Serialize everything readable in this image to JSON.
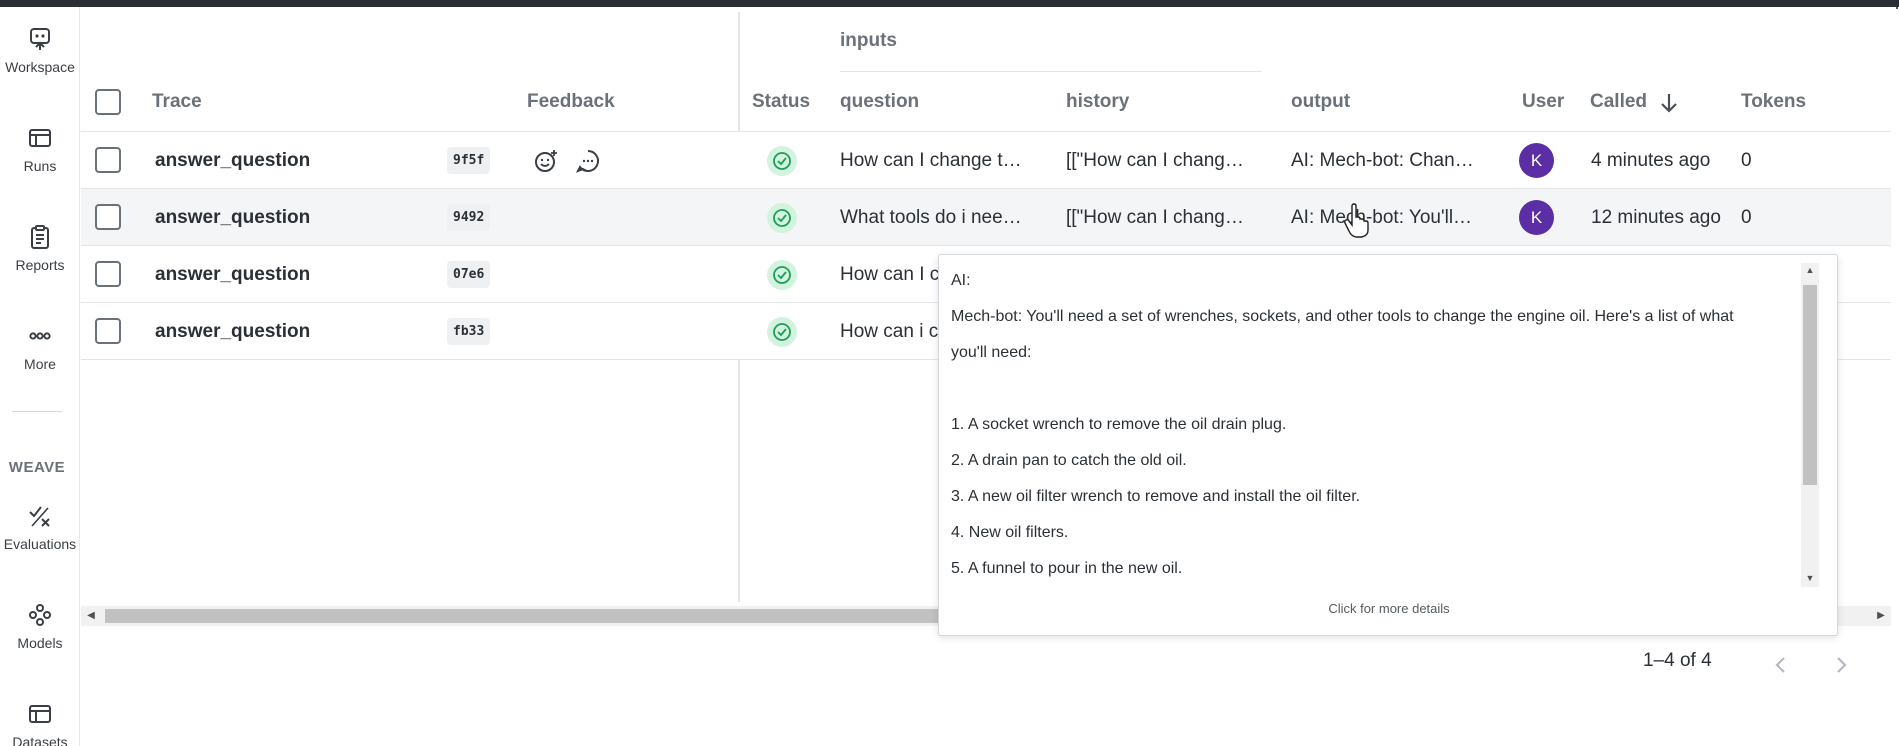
{
  "sidebar": {
    "items": [
      {
        "label": "Workspace",
        "icon": "workspace-icon"
      },
      {
        "label": "Runs",
        "icon": "runs-icon"
      },
      {
        "label": "Reports",
        "icon": "reports-icon"
      },
      {
        "label": "More",
        "icon": "more-icon"
      },
      {
        "label": "Evaluations",
        "icon": "evaluations-icon"
      },
      {
        "label": "Models",
        "icon": "models-icon"
      },
      {
        "label": "Datasets",
        "icon": "datasets-icon"
      }
    ],
    "section_label": "WEAVE"
  },
  "table": {
    "group_header": "inputs",
    "columns": {
      "trace": "Trace",
      "feedback": "Feedback",
      "status": "Status",
      "question": "question",
      "history": "history",
      "output": "output",
      "user": "User",
      "called": "Called",
      "tokens": "Tokens"
    },
    "rows": [
      {
        "name": "answer_question",
        "id": "9f5f",
        "question": "How can I change t…",
        "history": "[[\"How can I chang…",
        "output": "AI: Mech-bot: Chan…",
        "user": "K",
        "called": "4 minutes ago",
        "tokens": "0"
      },
      {
        "name": "answer_question",
        "id": "9492",
        "question": "What tools do i nee…",
        "history": "[[\"How can I chang…",
        "output": "AI: Mech-bot: You'll…",
        "user": "K",
        "called": "12 minutes ago",
        "tokens": "0"
      },
      {
        "name": "answer_question",
        "id": "07e6",
        "question": "How can I c",
        "history": "",
        "output": "",
        "user": "",
        "called": "",
        "tokens": ""
      },
      {
        "name": "answer_question",
        "id": "fb33",
        "question": "How can i c",
        "history": "",
        "output": "",
        "user": "",
        "called": "",
        "tokens": ""
      }
    ]
  },
  "popover": {
    "lines": [
      "AI:",
      "Mech-bot: You'll need a set of wrenches, sockets, and other tools to change the engine oil. Here's a list of what",
      "you'll need:",
      "",
      "1. A socket wrench to remove the oil drain plug.",
      "2. A drain pan to catch the old oil.",
      "3. A new oil filter wrench to remove and install the oil filter.",
      "4. New oil filters.",
      "5. A funnel to pour in the new oil."
    ],
    "footer": "Click for more details"
  },
  "pagination": {
    "range": "1–4 of 4"
  },
  "colors": {
    "avatar": "#5b2ea6",
    "status_ok_bg": "#d3f3df",
    "status_ok_fg": "#1d9e5a"
  }
}
